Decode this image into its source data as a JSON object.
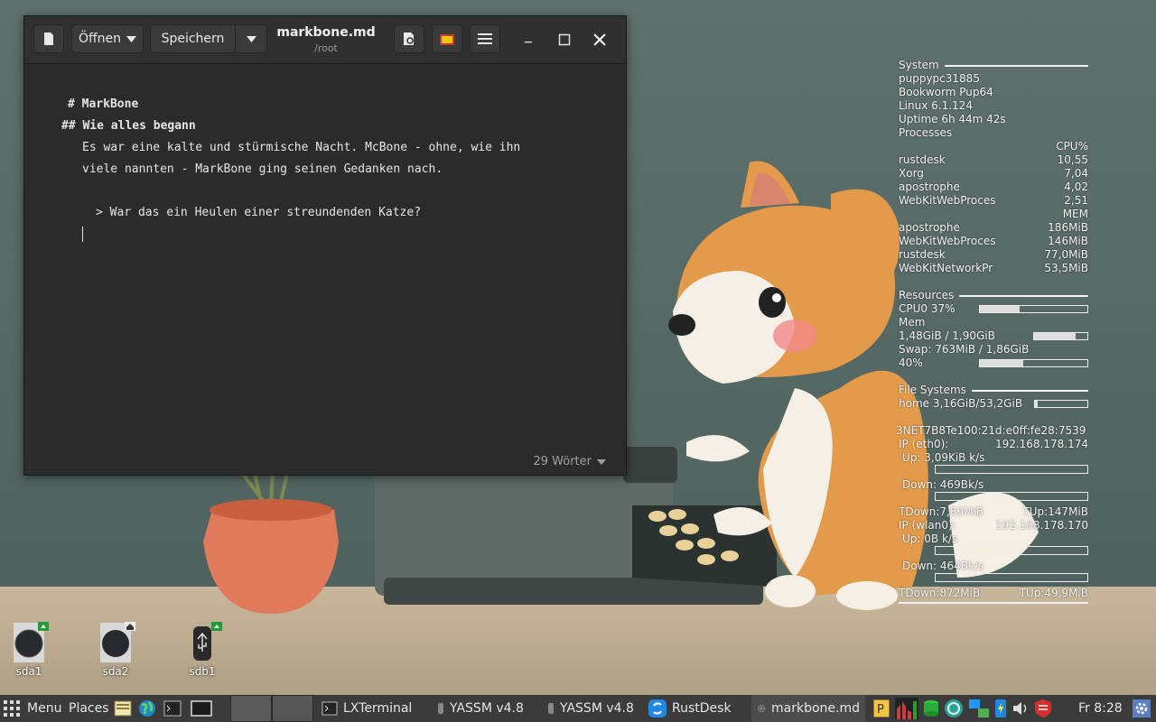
{
  "editor": {
    "open_label": "Öffnen",
    "save_label": "Speichern",
    "doc_title": "markbone.md",
    "doc_path": "/root",
    "lines": [
      "# MarkBone",
      "## Wie alles begann",
      "Es war eine kalte und stürmische Nacht. McBone - ohne, wie ihn",
      "viele nannten - MarkBone ging seinen Gedanken nach.",
      "> War das ein Heulen einer streundenden Katze?"
    ],
    "word_count": "29 Wörter"
  },
  "conky": {
    "system_title": "System",
    "hostname": "puppypc31885",
    "distro": "Bookworm Pup64",
    "kernel": "Linux 6.1.124",
    "uptime": "Uptime 6h 44m 42s",
    "processes_title": "Processes",
    "cpu_header": "CPU%",
    "cpu_procs": [
      {
        "name": "rustdesk",
        "value": "10,55"
      },
      {
        "name": "Xorg",
        "value": "7,04"
      },
      {
        "name": "apostrophe",
        "value": "4,02"
      },
      {
        "name": "WebKitWebProces",
        "value": "2,51"
      }
    ],
    "mem_header": "MEM",
    "mem_procs": [
      {
        "name": "apostrophe",
        "value": "186MiB"
      },
      {
        "name": "WebKitWebProces",
        "value": "146MiB"
      },
      {
        "name": "rustdesk",
        "value": "77,0MiB"
      },
      {
        "name": "WebKitNetworkPr",
        "value": "53,5MiB"
      }
    ],
    "resources_title": "Resources",
    "cpu0": "CPU0 37%",
    "cpu0_level": 0.37,
    "mem_label": "Mem",
    "mem_value": "1,48GiB / 1,90GiB",
    "mem_level": 0.78,
    "swap_value": "Swap: 763MiB / 1,86GiB",
    "swap_percent": "40%",
    "swap_level": 0.4,
    "fs_title": "File Systems",
    "fs_home": "home 3,16GiB/53,2GiB",
    "fs_level": 0.06,
    "net_ipv6": "3NET7B8Te100:21d:e0ff:fe28:7539",
    "eth_label": "IP (eth0):",
    "eth_ip": "192.168.178.174",
    "eth_up": "Up: 3,09KiB k/s",
    "eth_down": "Down: 469Bk/s",
    "eth_tdown": "TDown:7,89MiB",
    "eth_tup": "TUp:147MiB",
    "wlan_label": "IP (wlan0):",
    "wlan_ip": "192.168.178.170",
    "wlan_up": "Up: 0B k/s",
    "wlan_down": "Down: 464Bk/s",
    "wlan_tdown": "TDown:872MiB",
    "wlan_tup": "TUp:49,9MiB"
  },
  "desktop_icons": [
    {
      "label": "sda1"
    },
    {
      "label": "sda2"
    },
    {
      "label": "sdb1"
    }
  ],
  "taskbar": {
    "menu_label": "Menu",
    "places_label": "Places",
    "tasks": [
      {
        "label": "LXTerminal"
      },
      {
        "label": "YASSM v4.8"
      },
      {
        "label": "YASSM v4.8"
      },
      {
        "label": "RustDesk"
      },
      {
        "label": "markbone.md"
      }
    ],
    "clock": "Fr  8:28"
  },
  "colors": {
    "editor_bg": "#2b2b2b",
    "taskbar_bg": "#3b3b3b",
    "wall_teal": "#5d6f6b",
    "dog_orange": "#e39a4a"
  }
}
